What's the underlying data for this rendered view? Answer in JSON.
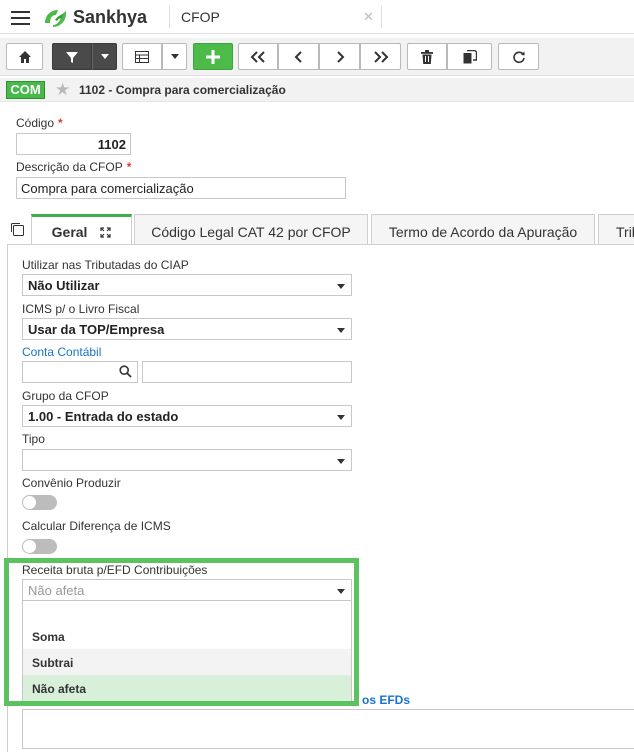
{
  "app": {
    "logo_text": "Sankhya",
    "screen_title": "CFOP",
    "close_glyph": "✕"
  },
  "toolbar": {
    "buttons": [
      "home-icon",
      "filter-icon",
      "chevron-down-icon",
      "grid-icon",
      "chevron-down-icon",
      "add-icon",
      "first-icon",
      "previous-icon",
      "next-icon",
      "last-icon",
      "trash-icon",
      "copy-icon",
      "refresh-icon"
    ]
  },
  "record": {
    "badge": "COM",
    "title": "1102 - Compra para comercialização"
  },
  "form": {
    "codigo_label": "Código",
    "codigo_value": "1102",
    "descricao_label": "Descrição da CFOP",
    "descricao_value": "Compra para comercialização",
    "required_mark": "*"
  },
  "tabs": [
    {
      "label": "Geral"
    },
    {
      "label": "Código Legal CAT 42 por CFOP"
    },
    {
      "label": "Termo de Acordo da Apuração"
    },
    {
      "label": "Trib"
    }
  ],
  "geral": {
    "ciap_label": "Utilizar nas Tributadas do CIAP",
    "ciap_value": "Não Utilizar",
    "icms_label": "ICMS p/ o Livro Fiscal",
    "icms_value": "Usar da TOP/Empresa",
    "conta_label": "Conta Contábil",
    "conta_value": "",
    "conta_desc": "",
    "grupo_label": "Grupo da CFOP",
    "grupo_value": "1.00 - Entrada do estado",
    "tipo_label": "Tipo",
    "tipo_value": "",
    "convenio_label": "Convênio Produzir",
    "calcular_label": "Calcular Diferença de ICMS",
    "receita_label": "Receita bruta p/EFD Contribuições",
    "receita_value": "Não afeta",
    "receita_options": [
      "",
      "Soma",
      "Subtrai",
      "Não afeta"
    ],
    "efd_fragment": "os EFDs"
  },
  "colors": {
    "brand_green": "#4cbb4a",
    "highlight_green": "#5cc25f",
    "link_blue": "#1a73c9",
    "required_red": "#e23b2f"
  }
}
